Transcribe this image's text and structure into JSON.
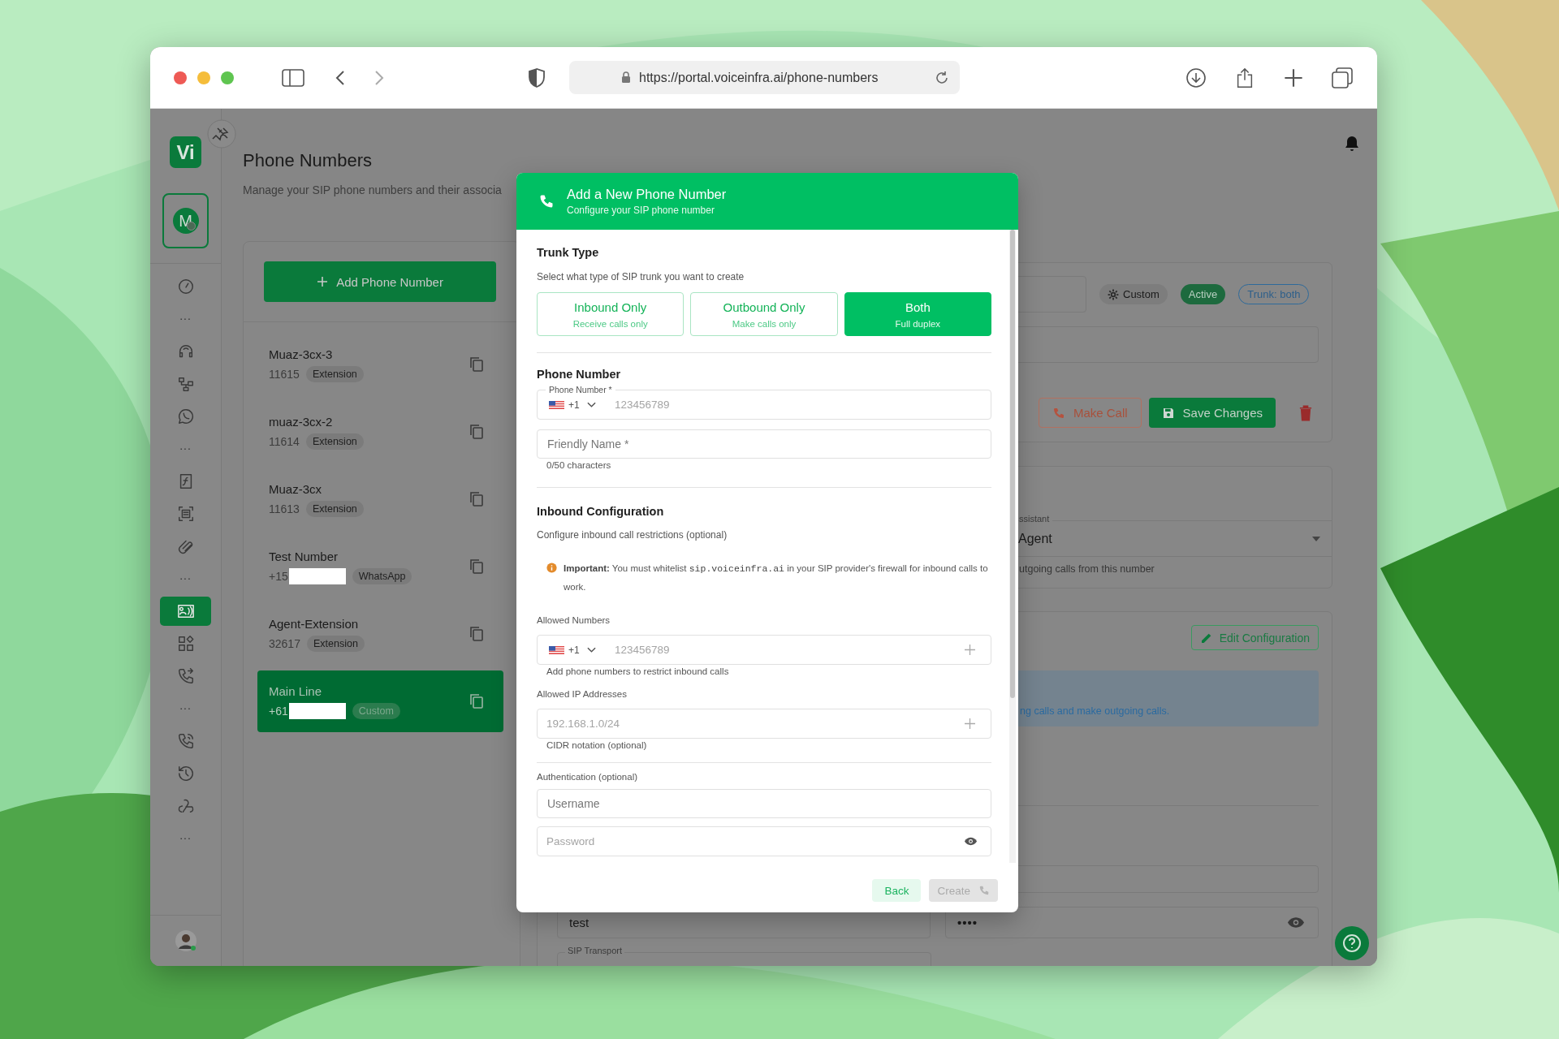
{
  "browser": {
    "url": "https://portal.voiceinfra.ai/phone-numbers"
  },
  "sidebar": {
    "logo": "Vi",
    "account_initial": "M",
    "items": [
      {
        "kind": "icon",
        "selected": false
      },
      {
        "kind": "more",
        "label": "..."
      },
      {
        "kind": "icon",
        "selected": false
      },
      {
        "kind": "icon",
        "selected": false
      },
      {
        "kind": "icon",
        "selected": false
      },
      {
        "kind": "more",
        "label": "..."
      },
      {
        "kind": "icon",
        "selected": false
      },
      {
        "kind": "icon",
        "selected": false
      },
      {
        "kind": "icon",
        "selected": false
      },
      {
        "kind": "more",
        "label": "..."
      },
      {
        "kind": "icon",
        "selected": true
      },
      {
        "kind": "icon",
        "selected": false
      },
      {
        "kind": "icon",
        "selected": false
      },
      {
        "kind": "more",
        "label": "..."
      },
      {
        "kind": "icon",
        "selected": false
      },
      {
        "kind": "icon",
        "selected": false
      },
      {
        "kind": "icon",
        "selected": false
      },
      {
        "kind": "more",
        "label": "..."
      }
    ]
  },
  "page": {
    "title": "Phone Numbers",
    "subtitle": "Manage your SIP phone numbers and their associa"
  },
  "numbers_list": {
    "add_button": "Add Phone Number",
    "items": [
      {
        "name": "Muaz-3cx-3",
        "number": "11615",
        "tag": "Extension",
        "redacted": false,
        "selected": false
      },
      {
        "name": "muaz-3cx-2",
        "number": "11614",
        "tag": "Extension",
        "redacted": false,
        "selected": false
      },
      {
        "name": "Muaz-3cx",
        "number": "11613",
        "tag": "Extension",
        "redacted": false,
        "selected": false
      },
      {
        "name": "Test Number",
        "number": "+15",
        "tag": "WhatsApp",
        "redacted": true,
        "selected": false
      },
      {
        "name": "Agent-Extension",
        "number": "32617",
        "tag": "Extension",
        "redacted": false,
        "selected": false
      },
      {
        "name": "Main Line",
        "number": "+61",
        "tag": "Custom",
        "redacted": true,
        "selected": true
      }
    ]
  },
  "detail": {
    "badges": [
      {
        "kind": "source",
        "label": "Custom"
      },
      {
        "kind": "status",
        "label": "Active"
      },
      {
        "kind": "trunk",
        "label": "Trunk: both"
      }
    ],
    "make_call": "Make Call",
    "save_changes": "Save Changes",
    "assistant": {
      "label": "ssistant",
      "value": "Agent",
      "hint": "utgoing calls from this number"
    },
    "edit_configuration": "Edit Configuration",
    "info": "ng calls and make outgoing calls.",
    "username_value": "test",
    "password_value": "••••",
    "transport_label": "SIP Transport"
  },
  "dialog": {
    "title": "Add a New Phone Number",
    "subtitle": "Configure your SIP phone number",
    "trunk": {
      "heading": "Trunk Type",
      "hint": "Select what type of SIP trunk you want to create",
      "options": [
        {
          "label": "Inbound Only",
          "sub": "Receive calls only",
          "selected": false
        },
        {
          "label": "Outbound Only",
          "sub": "Make calls only",
          "selected": false
        },
        {
          "label": "Both",
          "sub": "Full duplex",
          "selected": true
        }
      ]
    },
    "phone": {
      "heading": "Phone Number",
      "field_label": "Phone Number *",
      "code": "+1",
      "placeholder": "123456789",
      "friendly_placeholder": "Friendly Name *",
      "counter": "0/50 characters"
    },
    "inbound": {
      "heading": "Inbound Configuration",
      "hint": "Configure inbound call restrictions (optional)",
      "notice": {
        "lead": "Important:",
        "before": "You must whitelist",
        "code": "sip.voiceinfra.ai",
        "after": "in your SIP provider's firewall for inbound calls to work."
      },
      "allowed_numbers": {
        "label": "Allowed Numbers",
        "code": "+1",
        "placeholder": "123456789",
        "hint": "Add phone numbers to restrict inbound calls"
      },
      "allowed_ips": {
        "label": "Allowed IP Addresses",
        "placeholder": "192.168.1.0/24",
        "hint": "CIDR notation (optional)"
      },
      "auth": {
        "label": "Authentication (optional)",
        "username_placeholder": "Username",
        "password_placeholder": "Password"
      }
    },
    "back": "Back",
    "create": "Create",
    "create_disabled": true
  }
}
